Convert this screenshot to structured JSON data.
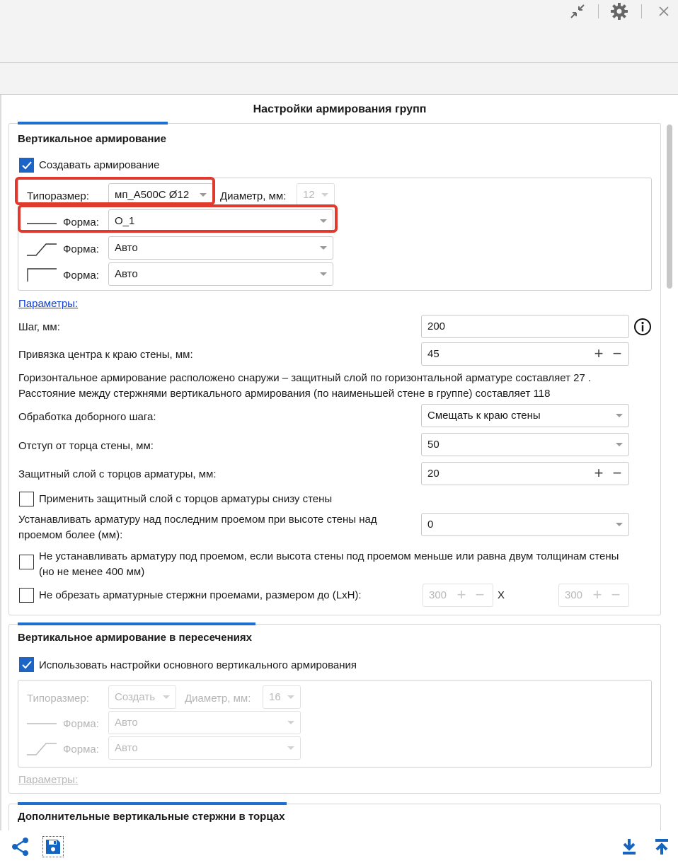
{
  "toolbar": {
    "collapse_icon": "collapse-arrows-icon",
    "settings_icon": "gear-icon",
    "close_icon": "close-icon"
  },
  "pane": {
    "title": "Настройки армирования групп"
  },
  "vertical": {
    "title": "Вертикальное армирование",
    "create_label": "Создавать армирование",
    "create_checked": true,
    "size_label": "Типоразмер:",
    "size_value": "мп_А500С Ø12",
    "diameter_label": "Диаметр, мм:",
    "diameter_value": "12",
    "shape1_label": "Форма:",
    "shape1_value": "О_1",
    "shape2_label": "Форма:",
    "shape2_value": "Авто",
    "shape3_label": "Форма:",
    "shape3_value": "Авто",
    "params_link": "Параметры:",
    "step_label": "Шаг, мм:",
    "step_value": "200",
    "anchor_label": "Привязка центра к краю стены, мм:",
    "anchor_value": "45",
    "info_line1": "Горизонтальное армирование расположено снаружи – защитный слой по горизонтальной арматуре составляет 27 .",
    "info_line2": "Расстояние между стержнями вертикального армирования (по наименьшей стене в группе) составляет 118",
    "extra_step_label": "Обработка доборного шага:",
    "extra_step_value": "Смещать к краю стены",
    "offset_label": "Отступ от торца стены, мм:",
    "offset_value": "50",
    "cover_label": "Защитный слой с торцов арматуры, мм:",
    "cover_value": "20",
    "apply_cover_label": "Применить защитный слой с торцов арматуры снизу стены",
    "apply_cover_checked": false,
    "above_opening_label_1": "Устанавливать арматуру над последним проемом при высоте стены над",
    "above_opening_label_2": "проемом более (мм):",
    "above_opening_value": "0",
    "below_opening_label_1": "Не устанавливать арматуру под проемом, если высота стены под проемом меньше или равна двум толщинам стены",
    "below_opening_label_2": "(но не менее 400 мм)",
    "below_opening_checked": false,
    "no_cut_label": "Не обрезать арматурные стержни проемами, размером до (LxH):",
    "no_cut_checked": false,
    "no_cut_l": "300",
    "no_cut_x": "X",
    "no_cut_h": "300"
  },
  "intersections": {
    "title": "Вертикальное армирование в пересечениях",
    "use_main_label": "Использовать настройки основного вертикального армирования",
    "use_main_checked": true,
    "size_label": "Типоразмер:",
    "size_value": "Создать",
    "diameter_label": "Диаметр, мм:",
    "diameter_value": "16",
    "shape1_label": "Форма:",
    "shape1_value": "Авто",
    "shape2_label": "Форма:",
    "shape2_value": "Авто",
    "params_link": "Параметры:"
  },
  "extra_ends": {
    "title": "Дополнительные вертикальные стержни в торцах"
  },
  "bottom": {
    "tree_icon": "share-tree-icon",
    "save_icon": "save-icon",
    "download_icon": "download-icon",
    "upload_icon": "upload-icon"
  }
}
